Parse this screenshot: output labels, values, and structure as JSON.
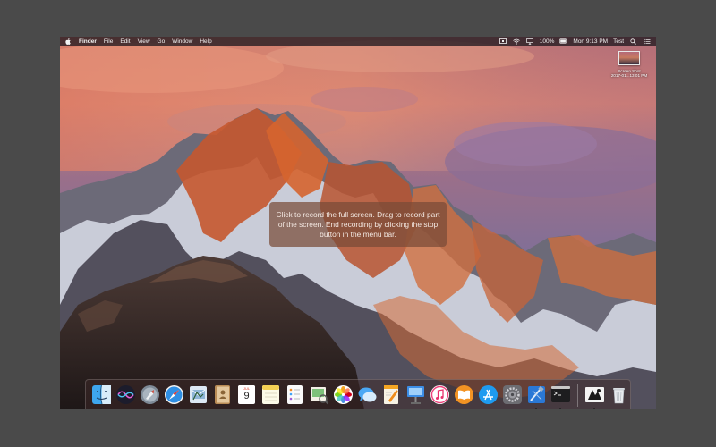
{
  "menubar": {
    "items": [
      "Finder",
      "File",
      "Edit",
      "View",
      "Go",
      "Window",
      "Help"
    ],
    "battery": "100%",
    "clock": "Mon 9:13 PM",
    "user": "Test"
  },
  "desktop": {
    "file_name": "Screen Shot",
    "file_date": "2017-01...13.01 PM"
  },
  "hint": {
    "text": "Click to record the full screen. Drag to record part of the screen. End recording by clicking the stop button in the menu bar."
  },
  "dock": {
    "calendar_month": "JUL",
    "calendar_day": "9",
    "icons": [
      "finder-icon",
      "siri-icon",
      "launchpad-icon",
      "safari-icon",
      "mail-icon",
      "contacts-icon",
      "calendar-icon",
      "notes-icon",
      "reminders-icon",
      "preview-icon",
      "photos-icon",
      "messages-icon",
      "pages-icon",
      "keynote-icon",
      "itunes-icon",
      "ibooks-icon",
      "app-store-icon",
      "system-preferences-icon",
      "xcode-icon",
      "terminal-icon",
      "quicktime-icon",
      "trash-icon"
    ]
  },
  "colors": {
    "menubar_bg": "#201a20",
    "hint_bg": "#784b37",
    "page_bg": "#4a4a4a"
  }
}
